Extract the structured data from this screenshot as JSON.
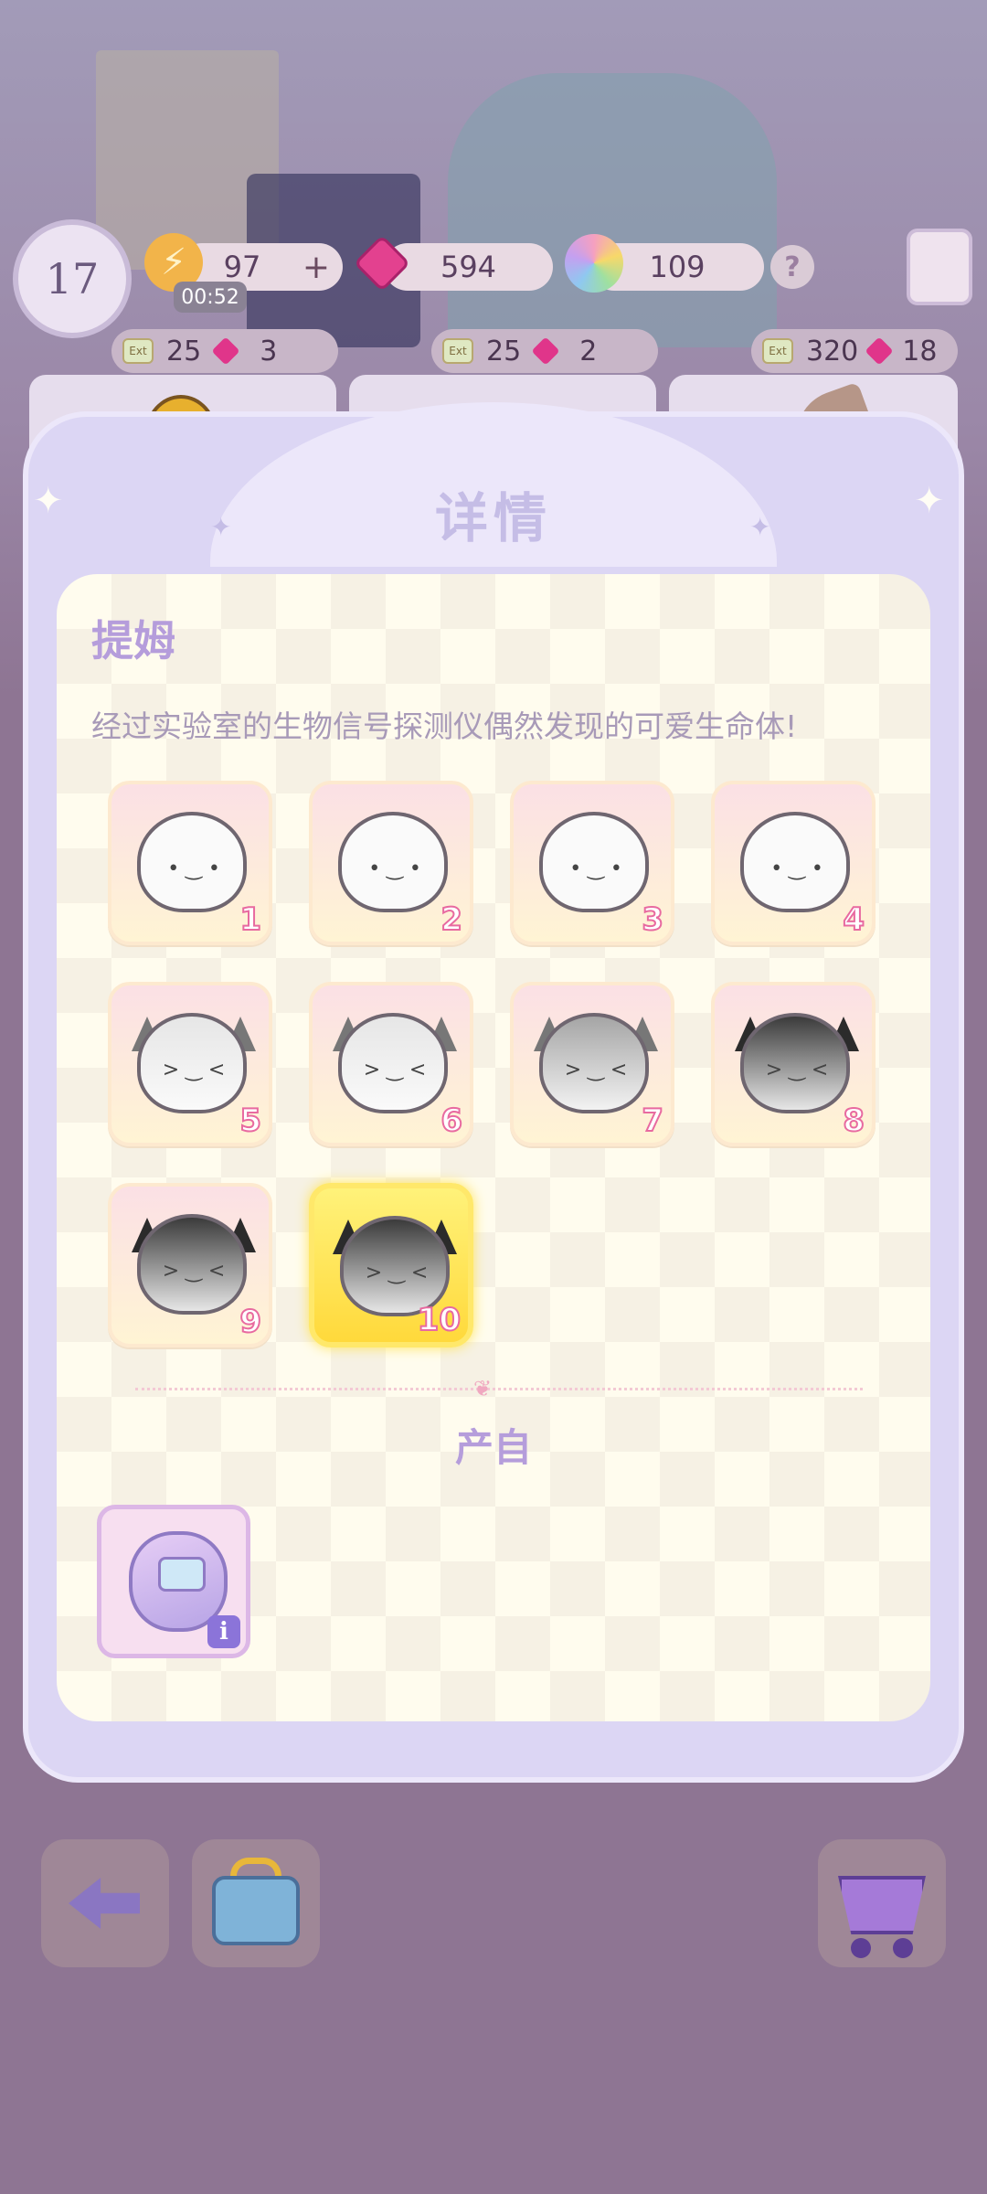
{
  "hud": {
    "level": "17",
    "energy": "97",
    "energy_plus": "+",
    "timer": "00:52",
    "gems": "594",
    "stars": "109",
    "help": "?"
  },
  "shop_costs": [
    {
      "ext": "Ext",
      "exp": "25",
      "gems": "3"
    },
    {
      "ext": "Ext",
      "exp": "25",
      "gems": "2"
    },
    {
      "ext": "Ext",
      "exp": "320",
      "gems": "18"
    }
  ],
  "modal": {
    "title": "详情",
    "pet_name": "提姆",
    "description": "经过实验室的生物信号探测仪偶然发现的可爱生命体!",
    "stages": [
      "1",
      "2",
      "3",
      "4",
      "5",
      "6",
      "7",
      "8",
      "9",
      "10"
    ],
    "selected_stage": "10",
    "source_title": "产自",
    "source_badge": "i"
  },
  "colors": {
    "modal_bg": "#dcd6f4",
    "panel_bg": "#fffcee",
    "accent_purple": "#b59ddb",
    "selected_yellow": "#ffd93b"
  },
  "icons": [
    "energy-bolt-icon",
    "gem-icon",
    "rainbow-star-icon",
    "help-icon",
    "card-icon",
    "back-arrow-icon",
    "bag-icon",
    "cart-icon",
    "info-icon"
  ]
}
